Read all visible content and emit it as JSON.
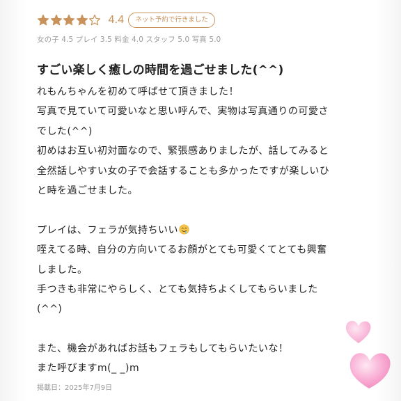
{
  "review": {
    "rating": 4,
    "rating_max": 5,
    "score_text": "4.4",
    "badge": "ネット予約で行きました",
    "subscores": "女の子 4.5 プレイ 3.5 料金 4.0 スタッフ 5.0 写真 5.0",
    "title": "すごい楽しく癒しの時間を過ごせました(^^)",
    "lines": [
      "れもんちゃんを初めて呼ばせて頂きました！",
      "写真で見ていて可愛いなと思い呼んで、実物は写真通りの可愛さ",
      "でした(^^)",
      "初めはお互い初対面なので、緊張感ありましたが、話してみると",
      "全然話しやすい女の子で会話することも多かったですが楽しいひ",
      "と時を過ごせました。",
      "",
      "プレイは、フェラが気持ちいい",
      "咥えてる時、自分の方向いてるお顔がとても可愛くてとても興奮",
      "しました。",
      "手つきも非常にやらしく、とても気持ちよくしてもらいました",
      "(^^)",
      "",
      "また、機会があればお話もフェラもしてもらいたいな！",
      "また呼びますm(_ _)m"
    ],
    "emoji_after_line": 7,
    "emoji_icon": "drooling-face-icon",
    "posted_date": "掲載日：2025年7月9日"
  },
  "colors": {
    "accent": "#c8925a",
    "text": "#222222",
    "muted": "#9a9a9a",
    "heart_light": "#f7a6cf",
    "heart_main": "#f58cc0"
  }
}
